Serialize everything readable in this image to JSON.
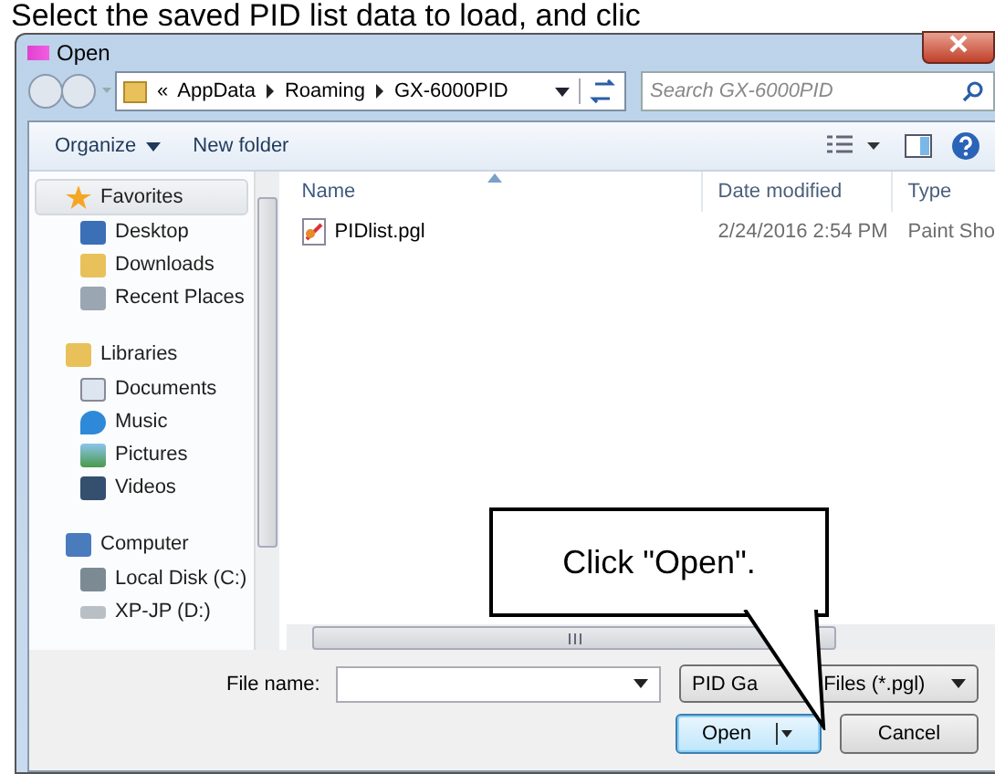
{
  "instruction": "Select the saved PID list data to load, and clic",
  "window": {
    "title": "Open"
  },
  "address": {
    "overflow": "«",
    "crumbs": [
      "AppData",
      "Roaming",
      "GX-6000PID"
    ]
  },
  "search": {
    "placeholder": "Search GX-6000PID"
  },
  "toolbar": [
    {
      "label": "Organize",
      "kind": "menu"
    },
    {
      "label": "New folder",
      "kind": "button"
    }
  ],
  "nav": [
    {
      "label": "Favorites",
      "selected": true,
      "children": [
        {
          "label": "Desktop",
          "selected": false
        },
        {
          "label": "Downloads",
          "selected": false
        },
        {
          "label": "Recent Places",
          "selected": false
        }
      ]
    },
    {
      "label": "Libraries",
      "selected": false,
      "children": [
        {
          "label": "Documents",
          "selected": false
        },
        {
          "label": "Music",
          "selected": false
        },
        {
          "label": "Pictures",
          "selected": false
        },
        {
          "label": "Videos",
          "selected": false
        }
      ]
    },
    {
      "label": "Computer",
      "selected": false,
      "children": [
        {
          "label": "Local Disk (C:)",
          "selected": false
        },
        {
          "label": "XP-JP (D:)",
          "selected": false
        }
      ]
    }
  ],
  "columns": [
    {
      "label": "Name",
      "sorted": true
    },
    {
      "label": "Date modified",
      "sorted": false
    },
    {
      "label": "Type",
      "sorted": false
    }
  ],
  "files": [
    {
      "name": "PIDlist.pgl",
      "date": "2/24/2016 2:54 PM",
      "type": "Paint Sho"
    }
  ],
  "file_name": {
    "label": "File name:"
  },
  "filter": {
    "text_before": "PID Ga",
    "text_after": "Files (*.pgl)"
  },
  "buttons": [
    {
      "label": "Open",
      "kind": "split"
    },
    {
      "label": "Cancel",
      "kind": "push"
    }
  ],
  "callout": {
    "text": "Click \"Open\"."
  }
}
